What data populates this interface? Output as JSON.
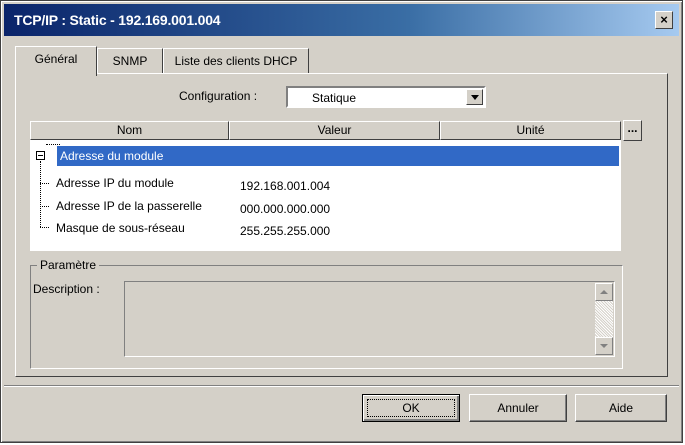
{
  "window": {
    "title": "TCP/IP : Static - 192.169.001.004",
    "close_label": "×"
  },
  "tabs": [
    {
      "label": "Général",
      "active": true
    },
    {
      "label": "SNMP",
      "active": false
    },
    {
      "label": "Liste des clients DHCP",
      "active": false
    }
  ],
  "configuration": {
    "label": "Configuration :",
    "selected": "Statique"
  },
  "grid": {
    "columns": [
      "Nom",
      "Valeur",
      "Unité"
    ],
    "ellipsis_label": "...",
    "group": {
      "name": "Adresse du module",
      "expander": "minus"
    },
    "items": [
      {
        "name": "Adresse IP du module",
        "value": "192.168.001.004"
      },
      {
        "name": "Adresse IP de la passerelle",
        "value": "000.000.000.000"
      },
      {
        "name": "Masque de sous-réseau",
        "value": "255.255.255.000"
      }
    ]
  },
  "parametre": {
    "legend": "Paramètre",
    "description_label": "Description :",
    "description_value": ""
  },
  "buttons": {
    "ok": "OK",
    "annuler": "Annuler",
    "aide": "Aide"
  },
  "colors": {
    "titlebar": "#0a246a",
    "selection": "#3169c6",
    "face": "#d4d0c8"
  }
}
